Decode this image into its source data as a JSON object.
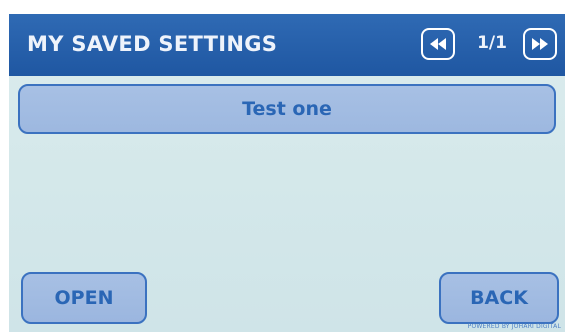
{
  "header": {
    "title": "MY SAVED SETTINGS",
    "page_indicator": "1/1",
    "prev_icon": "rewind-icon",
    "next_icon": "fast-forward-icon"
  },
  "saved_settings": [
    {
      "label": "Test one"
    }
  ],
  "actions": {
    "open_label": "OPEN",
    "back_label": "BACK"
  },
  "footer": {
    "watermark": "POWERED BY JOHARI DIGITAL"
  },
  "colors": {
    "header_bg": "#2058a4",
    "screen_bg": "#d6eaec",
    "button_bg": "#a3bde2",
    "button_border": "#3b72c0",
    "button_text": "#2a66b5",
    "header_text": "#eef3fb"
  }
}
